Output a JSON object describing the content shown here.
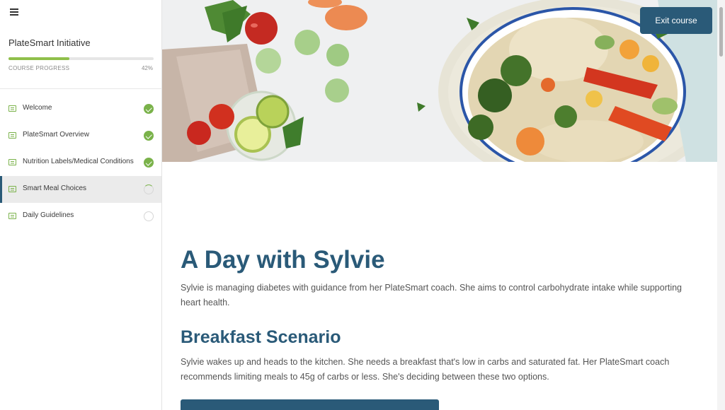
{
  "sidebar": {
    "course_title": "PlateSmart Initiative",
    "progress_label": "COURSE PROGRESS",
    "progress_percent": "42%",
    "progress_value": 0.42,
    "lessons": [
      {
        "label": "Welcome",
        "status": "complete"
      },
      {
        "label": "PlateSmart Overview",
        "status": "complete"
      },
      {
        "label": "Nutrition Labels/Medical Conditions",
        "status": "complete"
      },
      {
        "label": "Smart Meal Choices",
        "status": "in-progress"
      },
      {
        "label": "Daily Guidelines",
        "status": "not-started"
      }
    ],
    "active_lesson": "Smart Meal Choices"
  },
  "header": {
    "exit_label": "Exit course"
  },
  "content": {
    "heading": "A Day with Sylvie",
    "intro": "Sylvie is managing diabetes with guidance from her PlateSmart coach. She aims to control carbohydrate intake while supporting heart health.",
    "subheading": "Breakfast Scenario",
    "scenario": "Sylvie wakes up and heads to the kitchen. She needs a breakfast that's low in carbs and saturated fat. Her PlateSmart coach recommends limiting meals to 45g of carbs or less. She's deciding between these two options."
  },
  "colors": {
    "accent": "#2a5a78",
    "complete": "#7ab24a"
  },
  "icons": {
    "menu": "hamburger-icon",
    "lesson": "lesson-icon",
    "complete": "check-circle-icon"
  }
}
